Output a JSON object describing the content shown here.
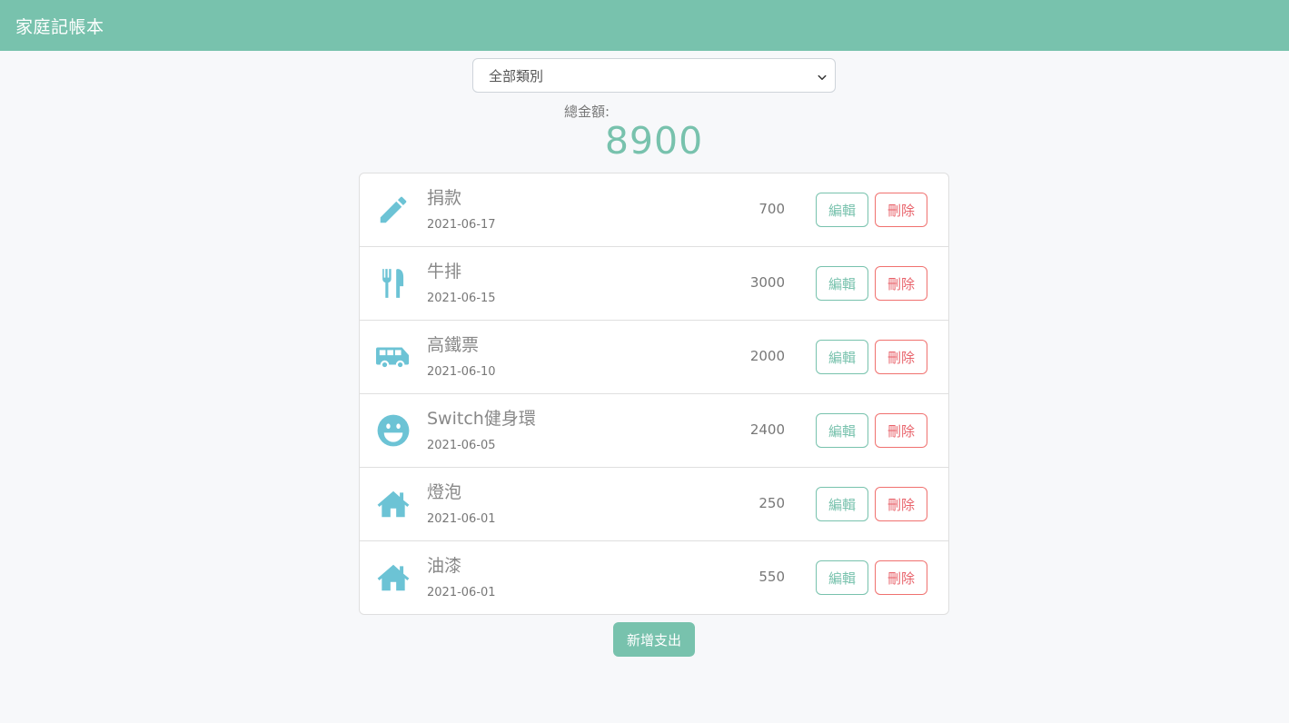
{
  "app": {
    "title": "家庭記帳本"
  },
  "filter": {
    "selected": "全部類別"
  },
  "summary": {
    "label": "總金額:",
    "total": "8900"
  },
  "colors": {
    "primary": "#78c2ad",
    "danger": "#f0716f",
    "icon": "#6cc3d5"
  },
  "actions": {
    "edit_label": "編輯",
    "delete_label": "刪除",
    "add_label": "新增支出"
  },
  "records": [
    {
      "icon": "pencil-icon",
      "name": "捐款",
      "date": "2021-06-17",
      "amount": "700"
    },
    {
      "icon": "utensils-icon",
      "name": "牛排",
      "date": "2021-06-15",
      "amount": "3000"
    },
    {
      "icon": "shuttle-van-icon",
      "name": "高鐵票",
      "date": "2021-06-10",
      "amount": "2000"
    },
    {
      "icon": "grin-icon",
      "name": "Switch健身環",
      "date": "2021-06-05",
      "amount": "2400"
    },
    {
      "icon": "home-icon",
      "name": "燈泡",
      "date": "2021-06-01",
      "amount": "250"
    },
    {
      "icon": "home-icon",
      "name": "油漆",
      "date": "2021-06-01",
      "amount": "550"
    }
  ]
}
